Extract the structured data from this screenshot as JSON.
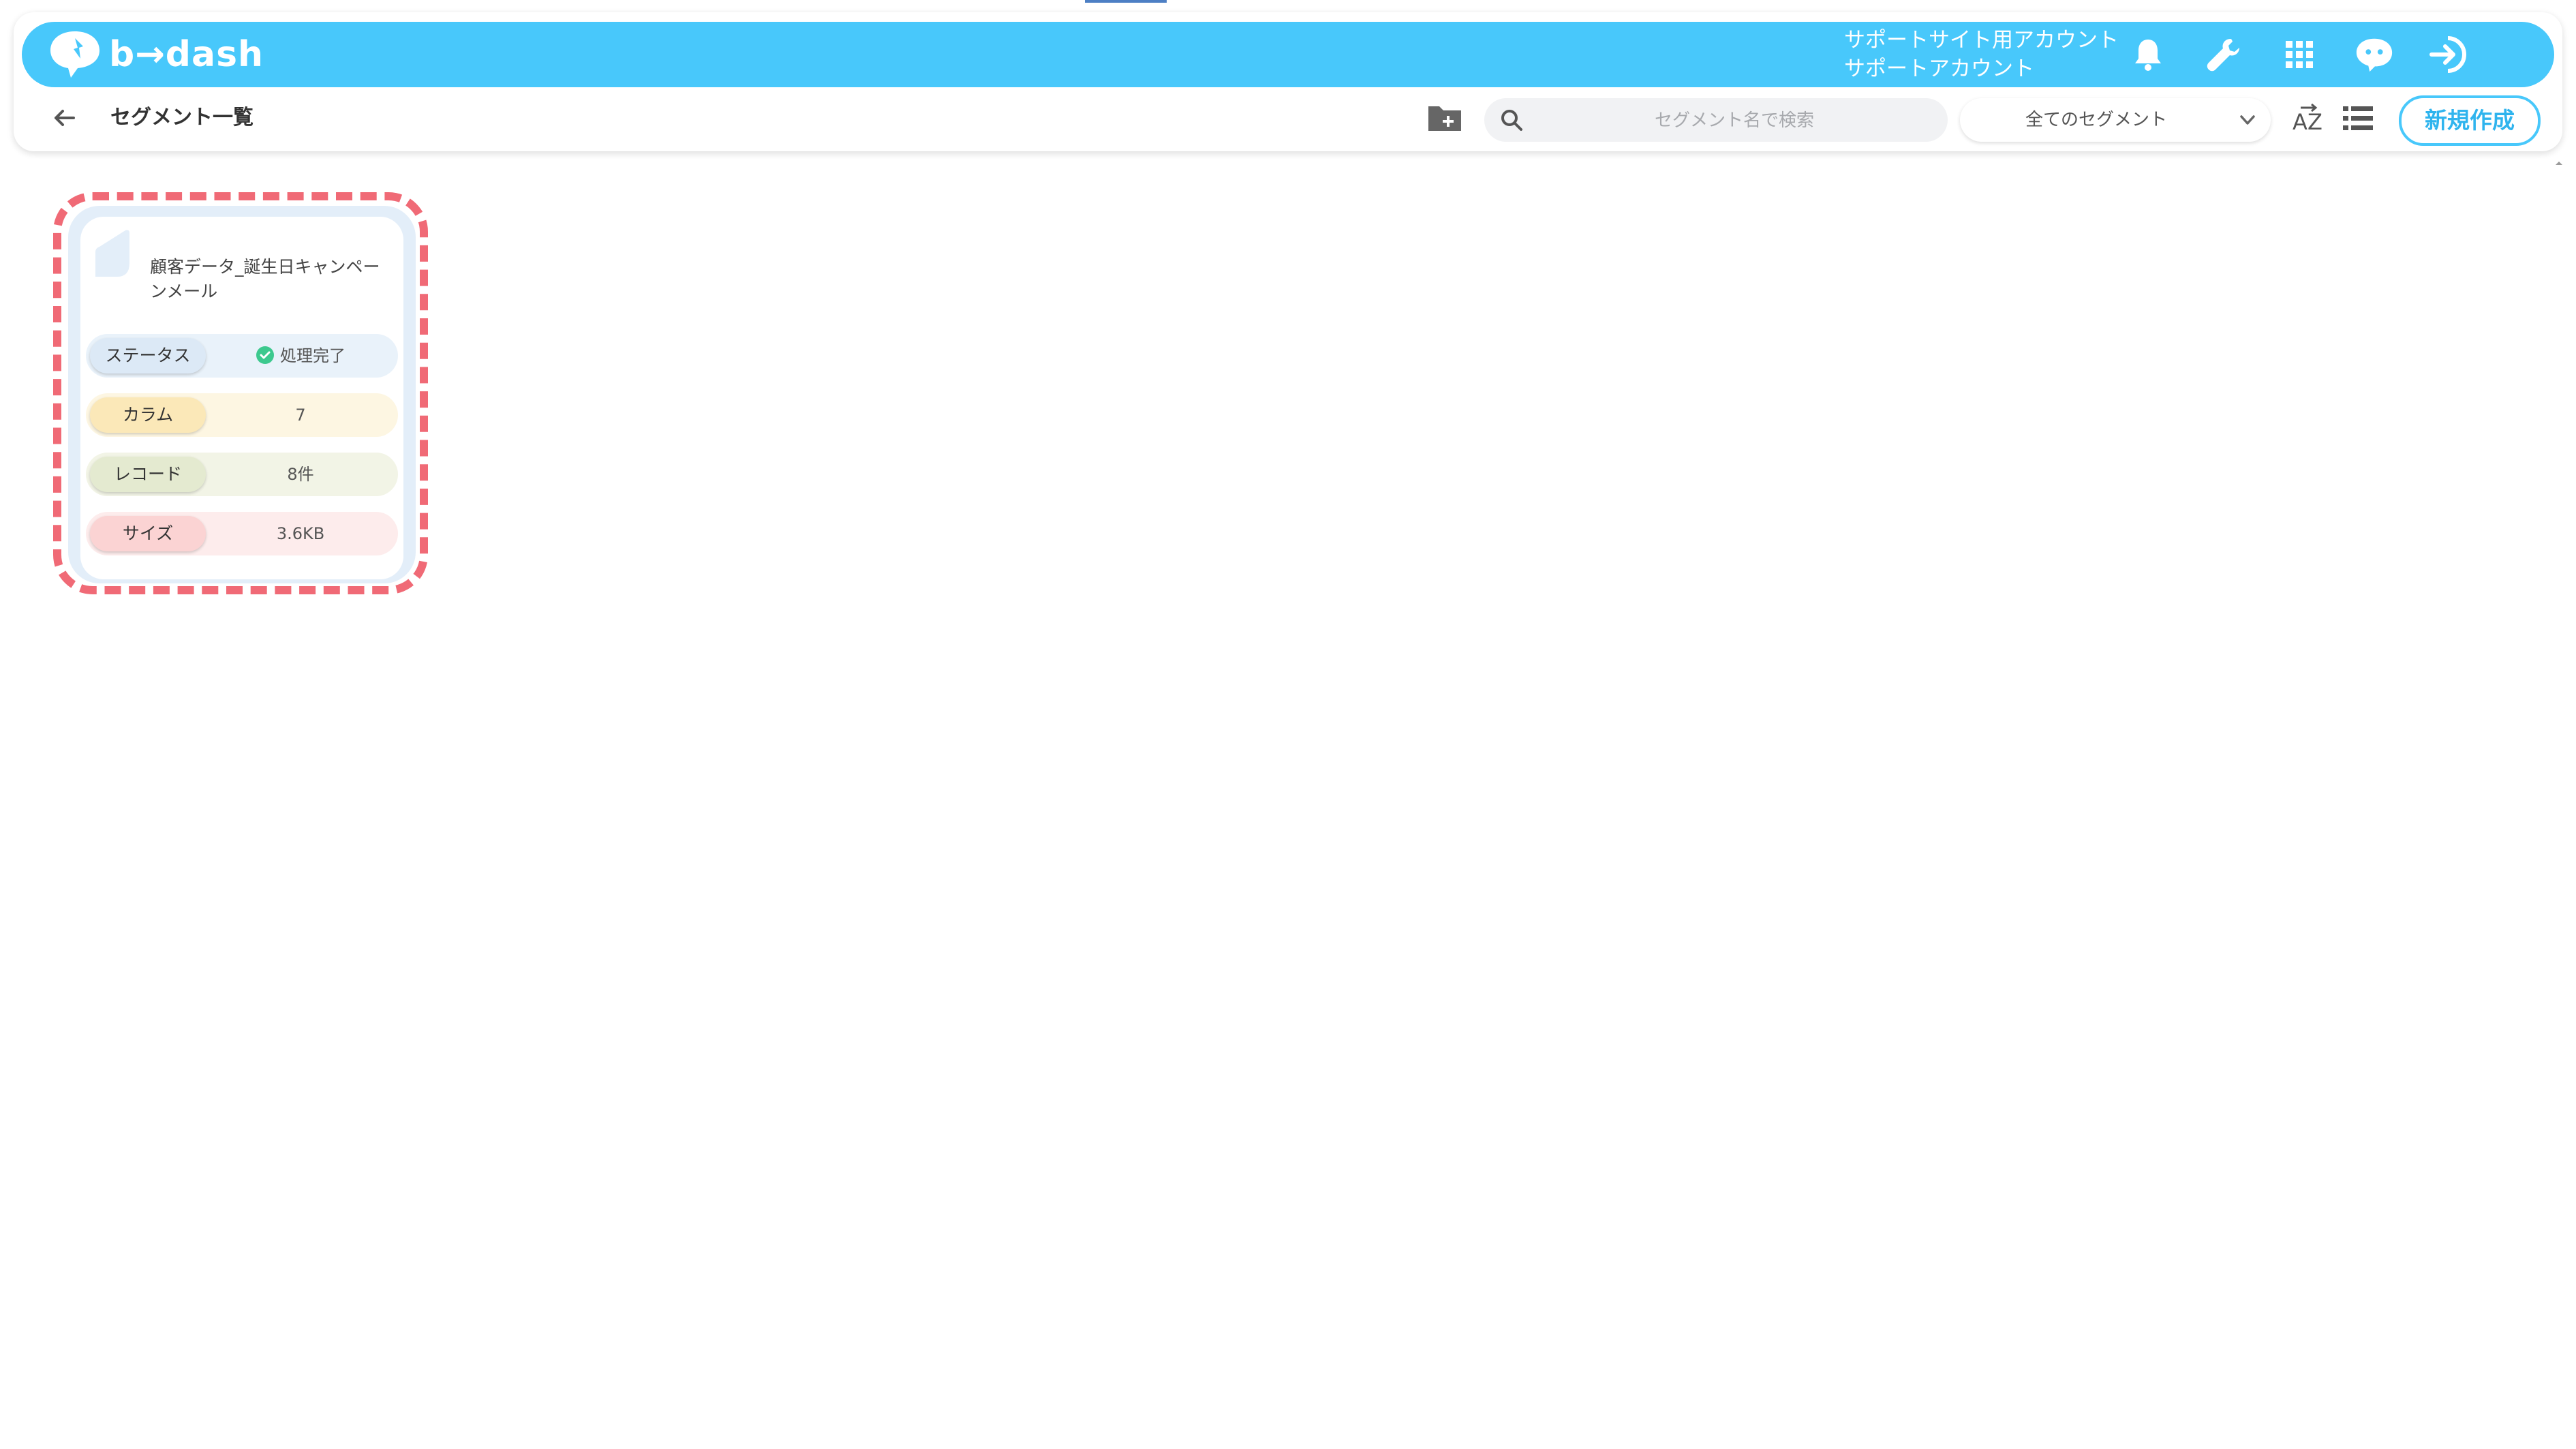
{
  "app": {
    "logo_text": "b→dash"
  },
  "account": {
    "line1": "サポートサイト用アカウント",
    "line2": "サポートアカウント"
  },
  "toolbar": {
    "page_title": "セグメント一覧",
    "search_placeholder": "セグメント名で検索",
    "filter_selected": "全てのセグメント",
    "new_button_label": "新規作成"
  },
  "icons": {
    "bell": "bell-icon",
    "wrench": "wrench-icon",
    "apps": "grid-icon",
    "chat": "chat-icon",
    "logout": "logout-icon",
    "back": "arrow-left-icon",
    "folder": "folder-plus-icon",
    "search": "search-icon",
    "sort": "sort-az-icon",
    "list": "list-view-icon",
    "check": "check-circle-icon"
  },
  "colors": {
    "brand": "#48c8fb",
    "highlight_dash": "#f06a76",
    "status_ok": "#3cc98e"
  },
  "segment_card": {
    "title": "顧客データ_誕生日キャンペーンメール",
    "status_label": "ステータス",
    "status_value": "処理完了",
    "column_label": "カラム",
    "column_value": "7",
    "record_label": "レコード",
    "record_value": "8件",
    "size_label": "サイズ",
    "size_value": "3.6KB"
  }
}
